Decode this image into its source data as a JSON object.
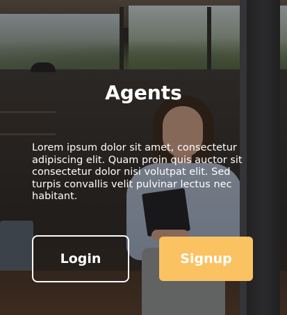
{
  "hero": {
    "title": "Agents",
    "description": "Lorem ipsum dolor sit amet, consectetur adipiscing elit. Quam proin quis auctor sit consectetur dolor nisi volutpat elit. Sed turpis convallis velit pulvinar lectus nec habitant."
  },
  "actions": {
    "login_label": "Login",
    "signup_label": "Signup"
  },
  "colors": {
    "signup_background": "#fbc262",
    "text": "#ffffff"
  }
}
